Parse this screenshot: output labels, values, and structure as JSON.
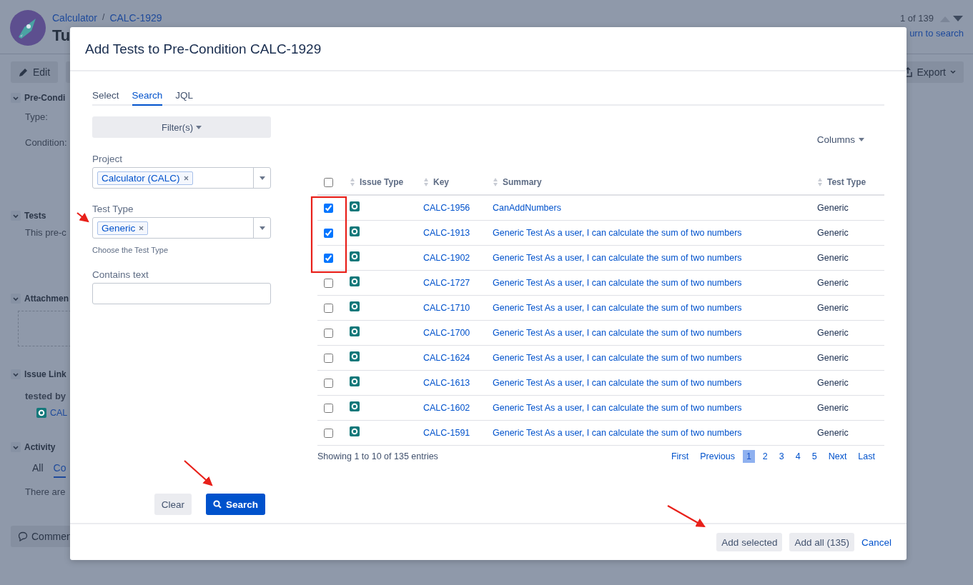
{
  "background": {
    "breadcrumb": {
      "project": "Calculator",
      "separator": "/",
      "issue": "CALC-1929"
    },
    "title": "Tu",
    "pager": "1 of 139",
    "return_link": "urn to search",
    "toolbar": {
      "edit": "Edit",
      "export": "Export"
    },
    "sections": [
      {
        "kind": "fields",
        "title": "Pre-Condi",
        "lines": [
          "Type:",
          "Condition:"
        ]
      },
      {
        "kind": "text",
        "title": "Tests",
        "lines": [
          "This pre-c"
        ]
      },
      {
        "kind": "dropzone",
        "title": "Attachmen"
      },
      {
        "kind": "links",
        "title": "Issue Link",
        "lines": [
          "tested by"
        ],
        "link": "CAL"
      },
      {
        "kind": "activity",
        "title": "Activity",
        "tabs": [
          {
            "label": "All",
            "selected": false
          },
          {
            "label": "Co",
            "selected": true
          }
        ],
        "lines": [
          "There are"
        ]
      }
    ],
    "comment_button": "Commen"
  },
  "dialog": {
    "title": "Add Tests to Pre-Condition CALC-1929",
    "tabs": [
      {
        "label": "Select",
        "selected": false
      },
      {
        "label": "Search",
        "selected": true
      },
      {
        "label": "JQL",
        "selected": false
      }
    ],
    "filters_button": "Filter(s)",
    "fields": [
      {
        "kind": "select",
        "label": "Project",
        "tags": [
          "Calculator (CALC)"
        ]
      },
      {
        "kind": "select",
        "label": "Test Type",
        "tags": [
          "Generic"
        ],
        "help": "Choose the Test Type"
      },
      {
        "kind": "text",
        "label": "Contains text"
      }
    ],
    "clear_button": "Clear",
    "search_button": "Search",
    "columns_button": "Columns",
    "table": {
      "columns": [
        "Issue Type",
        "Key",
        "Summary",
        "Test Type"
      ],
      "select_all_checked": false,
      "rows": [
        {
          "checked": true,
          "key": "CALC-1956",
          "summary": "CanAddNumbers",
          "test_type": "Generic"
        },
        {
          "checked": true,
          "key": "CALC-1913",
          "summary": "Generic Test As a user, I can calculate the sum of two numbers",
          "test_type": "Generic"
        },
        {
          "checked": true,
          "key": "CALC-1902",
          "summary": "Generic Test As a user, I can calculate the sum of two numbers",
          "test_type": "Generic"
        },
        {
          "checked": false,
          "key": "CALC-1727",
          "summary": "Generic Test As a user, I can calculate the sum of two numbers",
          "test_type": "Generic"
        },
        {
          "checked": false,
          "key": "CALC-1710",
          "summary": "Generic Test As a user, I can calculate the sum of two numbers",
          "test_type": "Generic"
        },
        {
          "checked": false,
          "key": "CALC-1700",
          "summary": "Generic Test As a user, I can calculate the sum of two numbers",
          "test_type": "Generic"
        },
        {
          "checked": false,
          "key": "CALC-1624",
          "summary": "Generic Test As a user, I can calculate the sum of two numbers",
          "test_type": "Generic"
        },
        {
          "checked": false,
          "key": "CALC-1613",
          "summary": "Generic Test As a user, I can calculate the sum of two numbers",
          "test_type": "Generic"
        },
        {
          "checked": false,
          "key": "CALC-1602",
          "summary": "Generic Test As a user, I can calculate the sum of two numbers",
          "test_type": "Generic"
        },
        {
          "checked": false,
          "key": "CALC-1591",
          "summary": "Generic Test As a user, I can calculate the sum of two numbers",
          "test_type": "Generic"
        }
      ]
    },
    "entries_info": "Showing 1 to 10 of 135 entries",
    "pagination": [
      {
        "label": "First",
        "selected": false
      },
      {
        "label": "Previous",
        "selected": false
      },
      {
        "label": "1",
        "selected": true
      },
      {
        "label": "2",
        "selected": false
      },
      {
        "label": "3",
        "selected": false
      },
      {
        "label": "4",
        "selected": false
      },
      {
        "label": "5",
        "selected": false
      },
      {
        "label": "Next",
        "selected": false
      },
      {
        "label": "Last",
        "selected": false
      }
    ],
    "footer_buttons": [
      {
        "kind": "secondary",
        "label": "Add selected"
      },
      {
        "kind": "secondary",
        "label": "Add all (135)"
      },
      {
        "kind": "link",
        "label": "Cancel"
      }
    ]
  }
}
